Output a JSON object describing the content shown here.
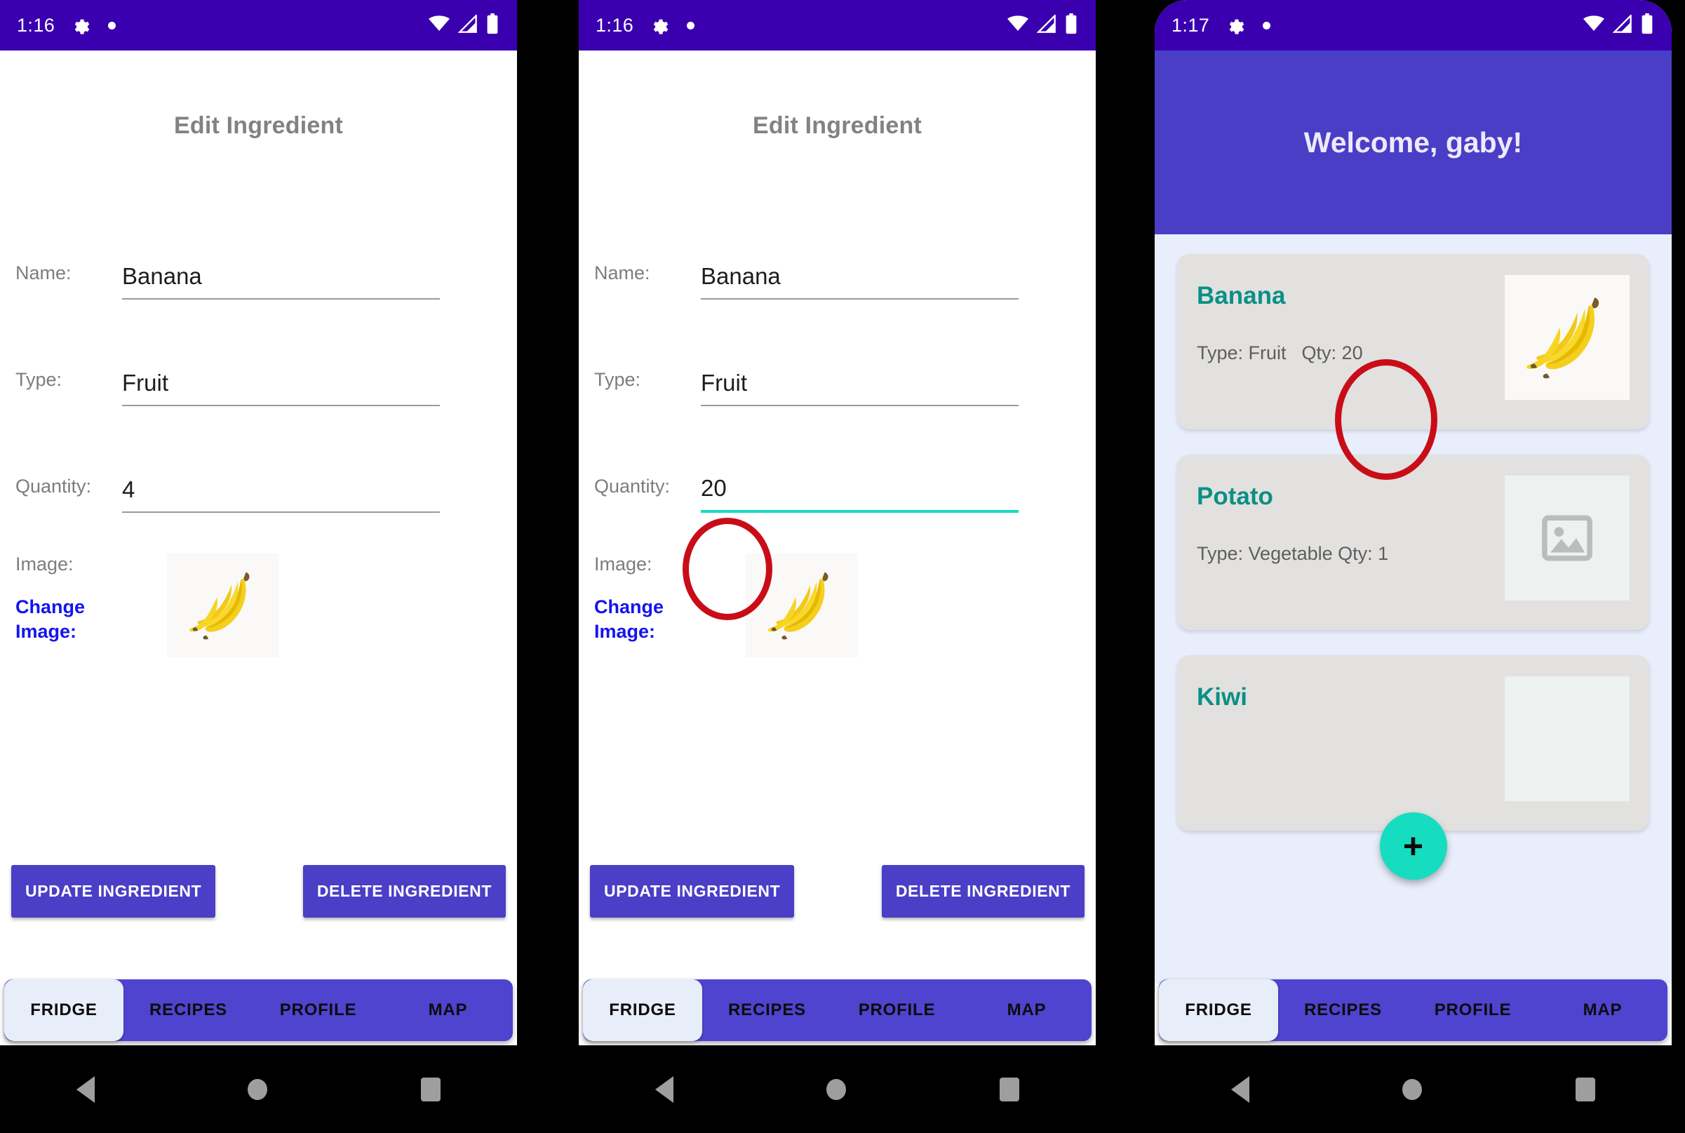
{
  "meta": {
    "background_color": "#000000",
    "accent_purple": "#4a3fc6",
    "status_purple": "#3a00b0",
    "teal": "#14dcc3",
    "card_title_teal": "#0a9086",
    "annotation_red": "#c90d18",
    "link_blue": "#1414ee"
  },
  "phones": [
    {
      "id": "phone-1",
      "status": {
        "time": "1:16",
        "gear": "gear-icon",
        "dot": "dot-icon",
        "wifi": "wifi-icon",
        "signal": "signal-icon",
        "battery": "battery-icon"
      },
      "screen": {
        "title": "Edit Ingredient",
        "fields": [
          {
            "label": "Name:",
            "value": "Banana",
            "focused": false
          },
          {
            "label": "Type:",
            "value": "Fruit",
            "focused": false
          },
          {
            "label": "Quantity:",
            "value": "4",
            "focused": false
          }
        ],
        "image_label": "Image:",
        "change_image_label": "Change Image:",
        "image_alt": "banana-bunch-photo",
        "buttons": {
          "update": "UPDATE INGREDIENT",
          "delete": "DELETE INGREDIENT"
        }
      },
      "tabs": [
        {
          "label": "FRIDGE",
          "active": true
        },
        {
          "label": "RECIPES",
          "active": false
        },
        {
          "label": "PROFILE",
          "active": false
        },
        {
          "label": "MAP",
          "active": false
        }
      ]
    },
    {
      "id": "phone-2",
      "status": {
        "time": "1:16",
        "gear": "gear-icon",
        "dot": "dot-icon",
        "wifi": "wifi-icon",
        "signal": "signal-icon",
        "battery": "battery-icon"
      },
      "screen": {
        "title": "Edit Ingredient",
        "fields": [
          {
            "label": "Name:",
            "value": "Banana",
            "focused": false
          },
          {
            "label": "Type:",
            "value": "Fruit",
            "focused": false
          },
          {
            "label": "Quantity:",
            "value": "20",
            "focused": true
          }
        ],
        "image_label": "Image:",
        "change_image_label": "Change Image:",
        "image_alt": "banana-bunch-photo",
        "buttons": {
          "update": "UPDATE INGREDIENT",
          "delete": "DELETE INGREDIENT"
        }
      },
      "tabs": [
        {
          "label": "FRIDGE",
          "active": true
        },
        {
          "label": "RECIPES",
          "active": false
        },
        {
          "label": "PROFILE",
          "active": false
        },
        {
          "label": "MAP",
          "active": false
        }
      ]
    },
    {
      "id": "phone-3",
      "status": {
        "time": "1:17",
        "gear": "gear-icon",
        "dot": "dot-icon",
        "wifi": "wifi-icon",
        "signal": "signal-icon",
        "battery": "battery-icon"
      },
      "screen": {
        "welcome": "Welcome, gaby!",
        "cards": [
          {
            "name": "Banana",
            "type_label": "Type: Fruit",
            "qty_label": "Qty: 20",
            "has_image": true,
            "image_alt": "banana-bunch-photo"
          },
          {
            "name": "Potato",
            "type_label": "Type: Vegetable",
            "qty_label": "Qty: 1",
            "has_image": false,
            "image_alt": "image-placeholder"
          },
          {
            "name": "Kiwi",
            "type_label": "",
            "qty_label": "",
            "has_image": false,
            "image_alt": "image-placeholder"
          }
        ],
        "fab_label": "+"
      },
      "tabs": [
        {
          "label": "FRIDGE",
          "active": true
        },
        {
          "label": "RECIPES",
          "active": false
        },
        {
          "label": "PROFILE",
          "active": false
        },
        {
          "label": "MAP",
          "active": false
        }
      ]
    }
  ]
}
